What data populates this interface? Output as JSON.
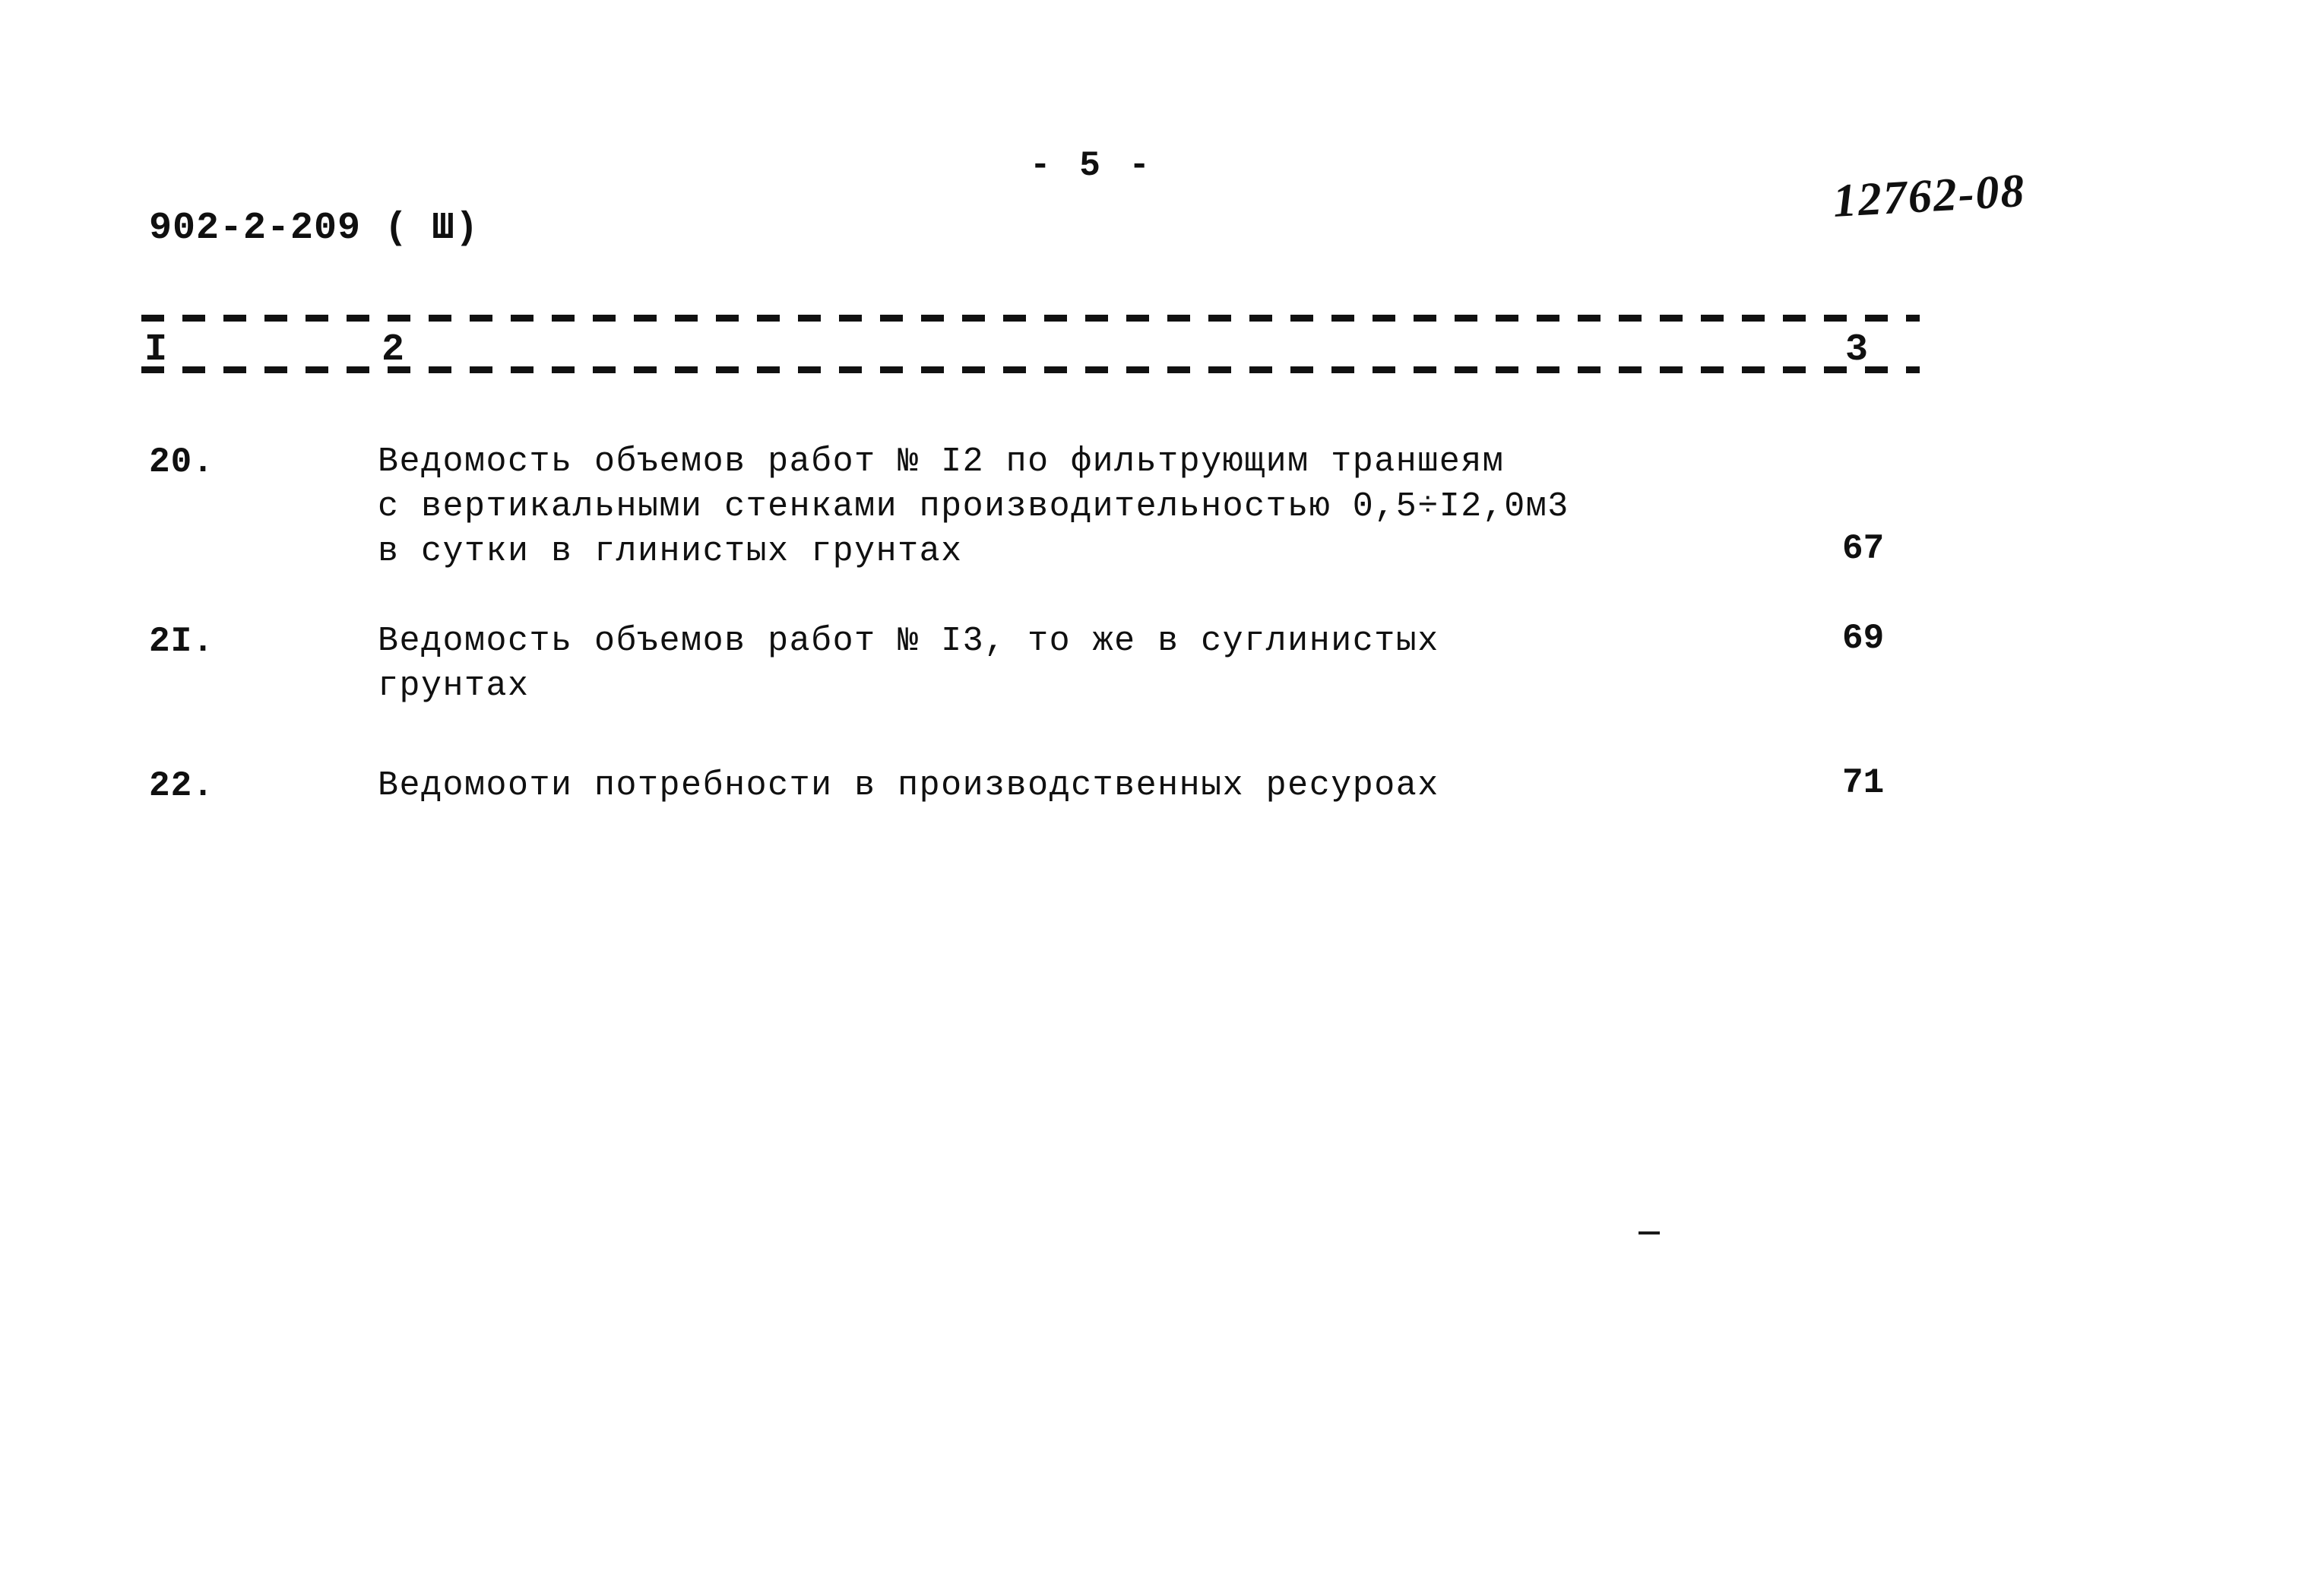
{
  "header": {
    "document_code": "902-2-209 ( Ш)",
    "page_label": "- 5 -",
    "handwritten_note": "12762-08"
  },
  "table": {
    "column_headers": {
      "col1": "I",
      "col2": "2",
      "col3": "3"
    },
    "rows": [
      {
        "number": "20.",
        "title": "Ведомость объемов работ № I2 по фильтрующим траншеям\nс вертикальными стенками производительностью 0,5÷I2,0м3\nв сутки в глинистых грунтах",
        "page": "67"
      },
      {
        "number": "2I.",
        "title": "Ведомость объемов работ № I3, то же в суглинистых\nгрунтах",
        "page": "69"
      },
      {
        "number": "22.",
        "title": "Ведомооти потребности в производственных ресуроах",
        "page": "71"
      }
    ]
  }
}
